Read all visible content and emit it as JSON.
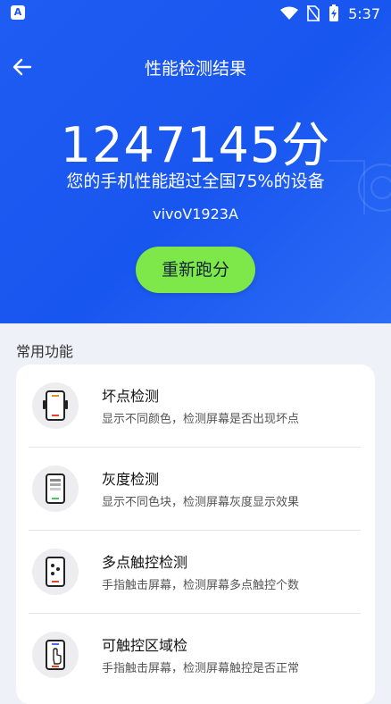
{
  "status_bar": {
    "time": "5:37",
    "app_icon_letter": "A"
  },
  "header": {
    "title": "性能检测结果",
    "back_icon": "arrow-left-icon"
  },
  "result": {
    "score": "1247145分",
    "description": "您的手机性能超过全国75%的设备",
    "device_model": "vivoV1923A",
    "retest_label": "重新跑分"
  },
  "section": {
    "title": "常用功能"
  },
  "features": [
    {
      "title": "坏点检测",
      "desc": "显示不同颜色，检测屏幕是否出现坏点",
      "icon": "phone-dead-pixel-icon"
    },
    {
      "title": "灰度检测",
      "desc": "显示不同色块，检测屏幕灰度显示效果",
      "icon": "phone-grayscale-icon"
    },
    {
      "title": "多点触控检测",
      "desc": "手指触击屏幕，检测屏幕多点触控个数",
      "icon": "phone-multitouch-icon"
    },
    {
      "title": "可触控区域检",
      "desc": "手指触击屏幕，检测屏幕触控是否正常",
      "icon": "phone-touch-area-icon"
    }
  ],
  "colors": {
    "hero_blue": "#1a57f0",
    "retest_green": "#7ee84a",
    "background": "#eef2f8"
  }
}
